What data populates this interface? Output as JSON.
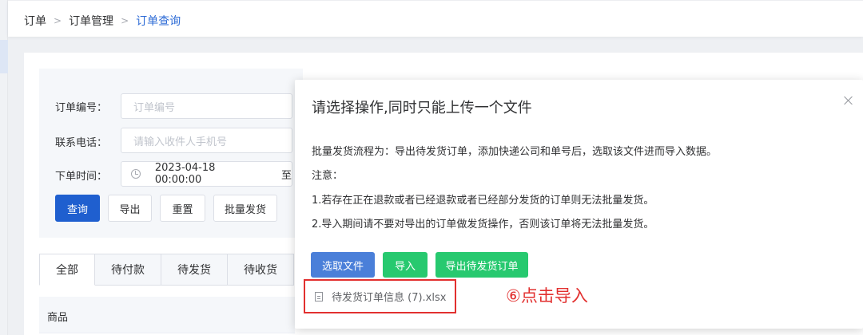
{
  "breadcrumb": {
    "items": [
      "订单",
      "订单管理",
      "订单查询"
    ]
  },
  "filters": {
    "order_no_label": "订单编号：",
    "order_no_placeholder": "订单编号",
    "phone_label": "联系电话：",
    "phone_placeholder": "请输入收件人手机号",
    "date_label": "下单时间：",
    "date_start": "2023-04-18 00:00:00",
    "date_to": "至"
  },
  "actions": {
    "query": "查询",
    "export": "导出",
    "reset": "重置",
    "batch_ship": "批量发货"
  },
  "tabs": [
    "全部",
    "待付款",
    "待发货",
    "待收货"
  ],
  "table": {
    "col_product": "商品"
  },
  "dialog": {
    "title": "请选择操作,同时只能上传一个文件",
    "flow": "批量发货流程为：导出待发货订单，添加快递公司和单号后，选取该文件进而导入数据。",
    "note_label": "注意：",
    "note_1": "1.若存在正在退款或者已经退款或者已经部分发货的订单则无法批量发货。",
    "note_2": "2.导入期间请不要对导出的订单做发货操作，否则该订单将无法批量发货。",
    "btn_select": "选取文件",
    "btn_import": "导入",
    "btn_export_pending": "导出待发货订单",
    "file_name": "待发货订单信息 (7).xlsx"
  },
  "annotation": "⑥点击导入",
  "colors": {
    "primary": "#1f5fcf",
    "select_blue": "#4a7fd9",
    "green": "#27c96f",
    "highlight_red": "#e2302f"
  }
}
